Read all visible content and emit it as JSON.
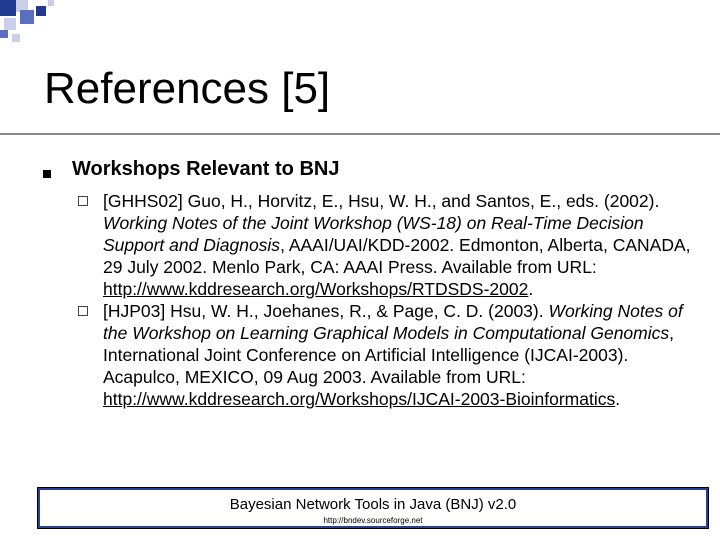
{
  "slide": {
    "title": "References [5]",
    "bullet": "Workshops Relevant to BNJ",
    "references": [
      {
        "key_authors": "[GHHS02] Guo, H., Horvitz, E., Hsu, W. H., and Santos, E., eds. (2002). ",
        "italic_title": "Working Notes of the Joint Workshop (WS-18) on Real-Time Decision Support and Diagnosis",
        "venue": ", AAAI/UAI/KDD-2002. Edmonton, Alberta, CANADA, 29 July 2002. Menlo Park, CA: AAAI Press. Available from URL: ",
        "url": "http://www.kddresearch.org/Workshops/RTDSDS-2002",
        "tail": "."
      },
      {
        "key_authors": "[HJP03] Hsu, W. H., Joehanes, R., & Page, C. D. (2003). ",
        "italic_title": "Working Notes of the Workshop on Learning Graphical Models in Computational Genomics",
        "venue": ", International Joint Conference on Artificial Intelligence (IJCAI-2003). Acapulco, MEXICO, 09 Aug 2003. Available from URL: ",
        "url": "http://www.kddresearch.org/Workshops/IJCAI-2003-Bioinformatics",
        "tail": "."
      }
    ],
    "footer": {
      "title": "Bayesian Network Tools in Java (BNJ) v2.0",
      "url": "http://bndev.sourceforge.net"
    }
  },
  "colors": {
    "accent_dark": "#1f3a8f",
    "accent_mid": "#5b6fc0",
    "accent_light": "#c9cfe8"
  }
}
